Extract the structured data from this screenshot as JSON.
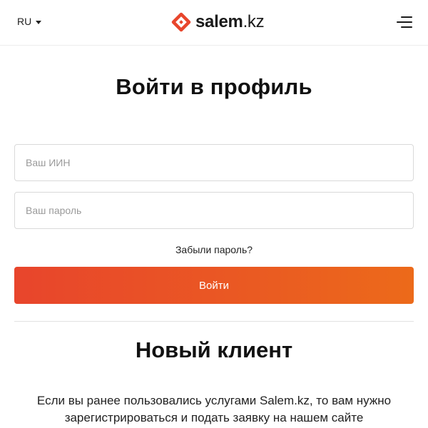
{
  "header": {
    "language": "RU",
    "logo_brand": "salem",
    "logo_tld": ".kz",
    "brand_color": "#e8452c",
    "menu_icon": "hamburger-menu-icon"
  },
  "login": {
    "title": "Войти в профиль",
    "iin_placeholder": "Ваш ИИН",
    "iin_value": "",
    "password_placeholder": "Ваш пароль",
    "password_value": "",
    "forgot_label": "Забыли пароль?",
    "submit_label": "Войти",
    "submit_gradient": [
      "#e8452c",
      "#ec6a1a"
    ]
  },
  "new_client": {
    "title": "Новый клиент",
    "description": "Если вы ранее пользовались услугами Salem.kz, то вам нужно зарегистрироваться и подать заявку на нашем сайте"
  }
}
